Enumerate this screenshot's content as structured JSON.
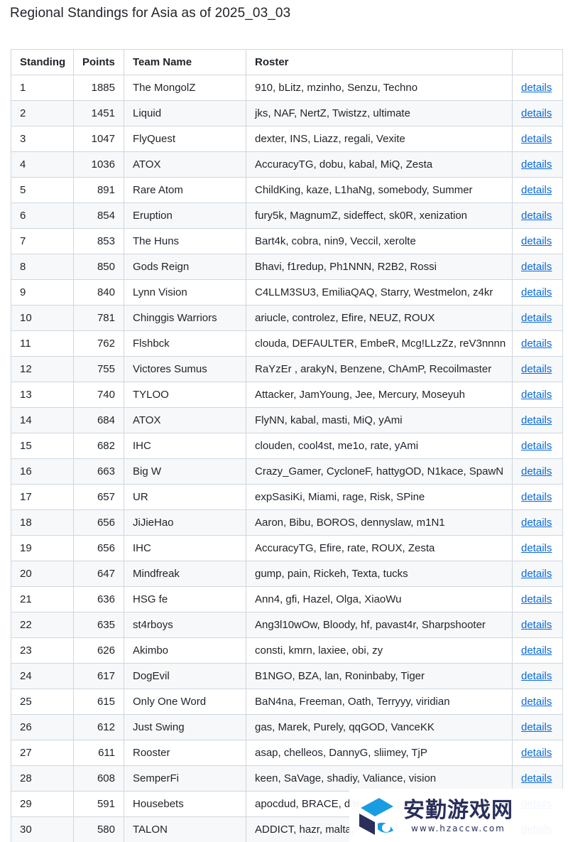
{
  "page": {
    "title": "Regional Standings for Asia as of 2025_03_03"
  },
  "table": {
    "headers": {
      "standing": "Standing",
      "points": "Points",
      "team": "Team Name",
      "roster": "Roster",
      "details": ""
    },
    "rows": [
      {
        "standing": "1",
        "points": "1885",
        "team": "The MongolZ",
        "roster": "910, bLitz, mzinho, Senzu, Techno",
        "details": "details"
      },
      {
        "standing": "2",
        "points": "1451",
        "team": "Liquid",
        "roster": "jks, NAF, NertZ, Twistzz, ultimate",
        "details": "details"
      },
      {
        "standing": "3",
        "points": "1047",
        "team": "FlyQuest",
        "roster": "dexter, INS, Liazz, regali, Vexite",
        "details": "details"
      },
      {
        "standing": "4",
        "points": "1036",
        "team": "ATOX",
        "roster": "AccuracyTG, dobu, kabal, MiQ, Zesta",
        "details": "details"
      },
      {
        "standing": "5",
        "points": "891",
        "team": "Rare Atom",
        "roster": "ChildKing, kaze, L1haNg, somebody, Summer",
        "details": "details"
      },
      {
        "standing": "6",
        "points": "854",
        "team": "Eruption",
        "roster": "fury5k, MagnumZ, sideffect, sk0R, xenization",
        "details": "details"
      },
      {
        "standing": "7",
        "points": "853",
        "team": "The Huns",
        "roster": "Bart4k, cobra, nin9, Veccil, xerolte",
        "details": "details"
      },
      {
        "standing": "8",
        "points": "850",
        "team": "Gods Reign",
        "roster": "Bhavi, f1redup, Ph1NNN, R2B2, Rossi",
        "details": "details"
      },
      {
        "standing": "9",
        "points": "840",
        "team": "Lynn Vision",
        "roster": "C4LLM3SU3, EmiliaQAQ, Starry, Westmelon, z4kr",
        "details": "details"
      },
      {
        "standing": "10",
        "points": "781",
        "team": "Chinggis Warriors",
        "roster": "ariucle, controlez, Efire, NEUZ, ROUX",
        "details": "details"
      },
      {
        "standing": "11",
        "points": "762",
        "team": "Flshbck",
        "roster": "clouda, DEFAULTER, EmbeR, Mcg!LLzZz, reV3nnnn",
        "details": "details"
      },
      {
        "standing": "12",
        "points": "755",
        "team": "Victores Sumus",
        "roster": "RaYzEr , arakyN, Benzene, ChAmP, Recoilmaster",
        "details": "details"
      },
      {
        "standing": "13",
        "points": "740",
        "team": "TYLOO",
        "roster": "Attacker, JamYoung, Jee, Mercury, Moseyuh",
        "details": "details"
      },
      {
        "standing": "14",
        "points": "684",
        "team": "ATOX",
        "roster": "FlyNN, kabal, masti, MiQ, yAmi",
        "details": "details"
      },
      {
        "standing": "15",
        "points": "682",
        "team": "IHC",
        "roster": "clouden, cool4st, me1o, rate, yAmi",
        "details": "details"
      },
      {
        "standing": "16",
        "points": "663",
        "team": "Big W",
        "roster": "Crazy_Gamer, CycloneF, hattygOD, N1kace, SpawN",
        "details": "details"
      },
      {
        "standing": "17",
        "points": "657",
        "team": "UR",
        "roster": "expSasiKi, Miami, rage, Risk, SPine",
        "details": "details"
      },
      {
        "standing": "18",
        "points": "656",
        "team": "JiJieHao",
        "roster": "Aaron, Bibu, BOROS, dennyslaw, m1N1",
        "details": "details"
      },
      {
        "standing": "19",
        "points": "656",
        "team": "IHC",
        "roster": "AccuracyTG, Efire, rate, ROUX, Zesta",
        "details": "details"
      },
      {
        "standing": "20",
        "points": "647",
        "team": "Mindfreak",
        "roster": "gump, pain, Rickeh, Texta, tucks",
        "details": "details"
      },
      {
        "standing": "21",
        "points": "636",
        "team": "HSG fe",
        "roster": "Ann4, gfi, Hazel, Olga, XiaoWu",
        "details": "details"
      },
      {
        "standing": "22",
        "points": "635",
        "team": "st4rboys",
        "roster": "Ang3l10wOw, Bloody, hf, pavast4r, Sharpshooter",
        "details": "details"
      },
      {
        "standing": "23",
        "points": "626",
        "team": "Akimbo",
        "roster": "consti, kmrn, laxiee, obi, zy",
        "details": "details"
      },
      {
        "standing": "24",
        "points": "617",
        "team": "DogEvil",
        "roster": "B1NGO, BZA, lan, Roninbaby, Tiger",
        "details": "details"
      },
      {
        "standing": "25",
        "points": "615",
        "team": "Only One Word",
        "roster": "BaN4na, Freeman, Oath, Terryyy, viridian",
        "details": "details"
      },
      {
        "standing": "26",
        "points": "612",
        "team": "Just Swing",
        "roster": "gas, Marek, Purely, qqGOD, VanceKK",
        "details": "details"
      },
      {
        "standing": "27",
        "points": "611",
        "team": "Rooster",
        "roster": "asap, chelleos, DannyG, sliimey, TjP",
        "details": "details"
      },
      {
        "standing": "28",
        "points": "608",
        "team": "SemperFi",
        "roster": "keen, SaVage, shadiy, Valiance, vision",
        "details": "details"
      },
      {
        "standing": "29",
        "points": "591",
        "team": "Housebets",
        "roster": "apocdud, BRACE, dar",
        "details": "details"
      },
      {
        "standing": "30",
        "points": "580",
        "team": "TALON",
        "roster": "ADDICT, hazr, malta,",
        "details": "details"
      }
    ]
  },
  "watermark": {
    "name": "安勤游戏网",
    "url": "www.hzaccw.com",
    "colors": {
      "blue": "#1a9de0",
      "navy": "#2a2f5a"
    }
  }
}
